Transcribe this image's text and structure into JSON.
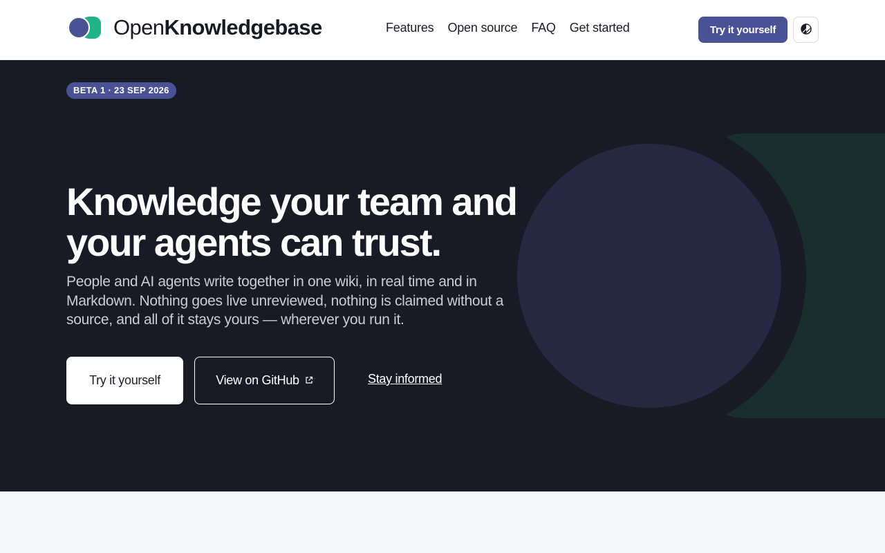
{
  "header": {
    "logo": {
      "text_light": "Open",
      "text_bold": "Knowledgebase"
    },
    "nav": [
      {
        "label": "Features"
      },
      {
        "label": "Open source"
      },
      {
        "label": "FAQ"
      },
      {
        "label": "Get started"
      }
    ],
    "cta_label": "Try it yourself",
    "theme_toggle_icon": "theme-toggle-icon"
  },
  "hero": {
    "badge": "BETA 1 · 23 SEP 2026",
    "headline": "Knowledge your team and your agents can trust.",
    "subtext": "People and AI agents write together in one wiki, in real time and in Markdown. Nothing goes live unreviewed, nothing is claimed without a source, and all of it stays yours — wherever you run it.",
    "buttons": {
      "primary": "Try it yourself",
      "github": "View on GitHub",
      "github_icon": "external-link-icon",
      "stay": "Stay informed"
    }
  },
  "colors": {
    "brand_blue": "#4a5296",
    "brand_green": "#1fb488",
    "hero_bg": "#181a26",
    "page_bg": "#f4f6fa"
  }
}
